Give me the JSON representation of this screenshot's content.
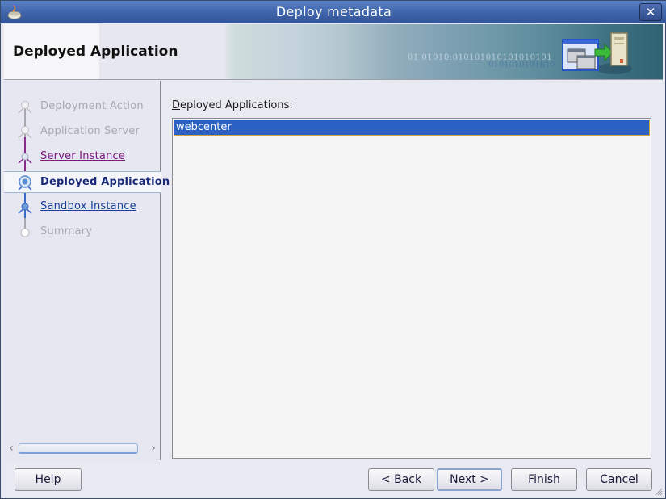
{
  "window": {
    "title": "Deploy metadata",
    "app_icon": "java-cup-icon",
    "close_icon": "close-icon",
    "close_glyph": "✕"
  },
  "header": {
    "title": "Deployed Application",
    "banner_binary_1": "01 01010:010101010101010101",
    "banner_binary_2": "0101010101010",
    "icon": "deploy-to-server-icon"
  },
  "train": {
    "steps": [
      {
        "label": "Deployment Action",
        "state": "disabled"
      },
      {
        "label": "Application Server",
        "state": "disabled"
      },
      {
        "label": "Server Instance",
        "state": "visited"
      },
      {
        "label": "Deployed Application",
        "state": "current"
      },
      {
        "label": "Sandbox Instance",
        "state": "next"
      },
      {
        "label": "Summary",
        "state": "disabled"
      }
    ],
    "scroll_left_glyph": "‹",
    "scroll_right_glyph": "›"
  },
  "main": {
    "list_label_mnemonic": "D",
    "list_label_rest": "eployed Applications:",
    "items": [
      {
        "label": "webcenter",
        "selected": true
      }
    ]
  },
  "buttons": {
    "help": {
      "mnemonic": "H",
      "rest": "elp"
    },
    "back": {
      "prefix": "< ",
      "mnemonic": "B",
      "rest": "ack"
    },
    "next": {
      "mnemonic": "N",
      "rest": "ext >"
    },
    "finish": {
      "mnemonic": "F",
      "rest": "inish"
    },
    "cancel": {
      "label": "Cancel"
    }
  },
  "colors": {
    "titlebar": "#3f64aa",
    "selection": "#2a62c4",
    "selection_border": "#d4a040",
    "visited_link": "#7a1a7a",
    "next_link": "#1a3f9a"
  }
}
